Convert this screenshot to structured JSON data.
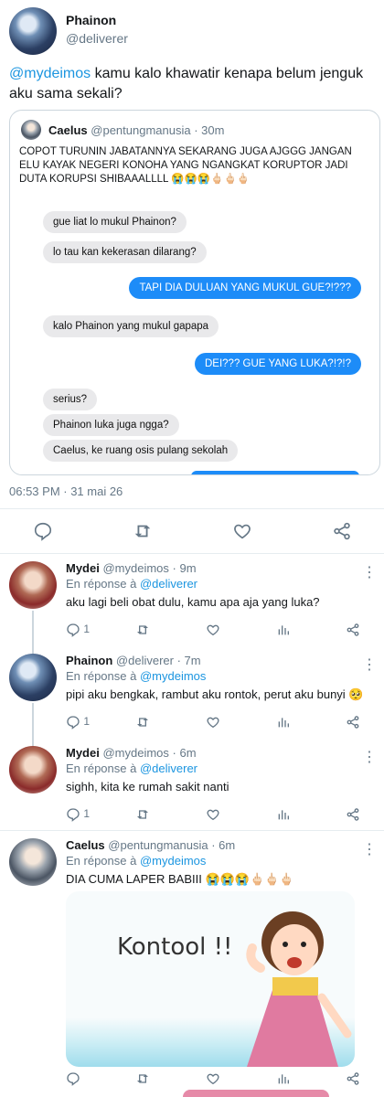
{
  "main_tweet": {
    "name": "Phainon",
    "handle": "@deliverer",
    "mention": "@mydeimos",
    "text": " kamu kalo khawatir kenapa belum jenguk aku sama sekali?",
    "date": "06:53 PM · 31 mai 26"
  },
  "quote": {
    "name": "Caelus",
    "handle": "@pentungmanusia",
    "time": "· 30m",
    "text": "COPOT TURUNIN JABATANNYA SEKARANG JUGA AJGGG JANGAN ELU KAYAK NEGERI KONOHA YANG NGANGKAT KORUPTOR JADI DUTA KORUPSI SHIBAAALLLL 😭😭😭🖕🏻🖕🏻🖕🏻",
    "chat": [
      {
        "text": "gue liat lo mukul Phainon?"
      },
      {
        "text": "lo tau kan kekerasan dilarang?"
      },
      {
        "text": "TAPI DIA DULUAN YANG MUKUL GUE?!???"
      },
      {
        "text": "kalo Phainon yang mukul gapapa"
      },
      {
        "text": "DEI??? GUE YANG LUKA?!?!?"
      },
      {
        "text": "serius?"
      },
      {
        "text": "Phainon luka juga ngga?"
      },
      {
        "text": "Caelus, ke ruang osis pulang sekolah"
      }
    ]
  },
  "replies": [
    {
      "name": "Mydei",
      "handle": "@mydeimos",
      "time": "· 9m",
      "reply_prefix": "En réponse à ",
      "reply_to": "@deliverer",
      "text": "aku lagi beli obat dulu, kamu apa aja yang luka?",
      "reply_count": "1"
    },
    {
      "name": "Phainon",
      "handle": "@deliverer",
      "time": "· 7m",
      "reply_prefix": "En réponse à ",
      "reply_to": "@mydeimos",
      "text": "pipi aku bengkak, rambut aku rontok, perut aku bunyi 🥺",
      "reply_count": "1"
    },
    {
      "name": "Mydei",
      "handle": "@mydeimos",
      "time": "· 6m",
      "reply_prefix": "En réponse à ",
      "reply_to": "@deliverer",
      "text": "sighh, kita ke rumah sakit nanti",
      "reply_count": "1"
    },
    {
      "name": "Caelus",
      "handle": "@pentungmanusia",
      "time": "· 6m",
      "reply_prefix": "En réponse à ",
      "reply_to": "@mydeimos",
      "text": "DIA CUMA LAPER BABIII 😭😭😭🖕🏻🖕🏻🖕🏻",
      "image_text": "Kontool !!"
    }
  ],
  "more_icon": "⋮",
  "colors": {
    "link": "#1b95e0",
    "outgoing_bubble": "#1d8cf8",
    "incoming_bubble": "#e9e9eb"
  }
}
